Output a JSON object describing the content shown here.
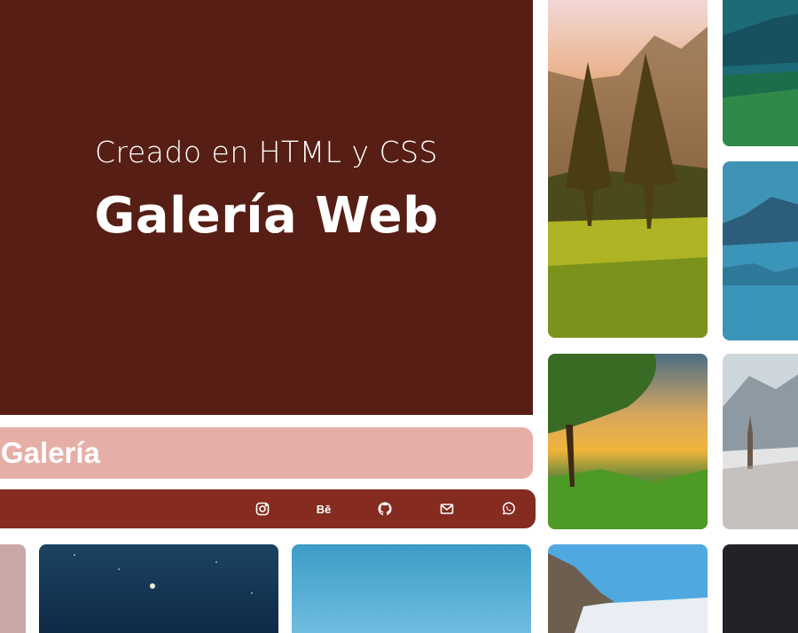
{
  "hero": {
    "subtitle": "Creado en HTML y CSS",
    "title": "Galería Web"
  },
  "gallery": {
    "label": "Galería"
  },
  "social": {
    "icons": [
      "instagram-icon",
      "behance-icon",
      "github-icon",
      "mail-icon",
      "whatsapp-icon"
    ],
    "behance_text": "Bē"
  },
  "colors": {
    "hero_bg": "#561e14",
    "gallery_bar": "#e5afa7",
    "social_bar": "#852b20"
  }
}
